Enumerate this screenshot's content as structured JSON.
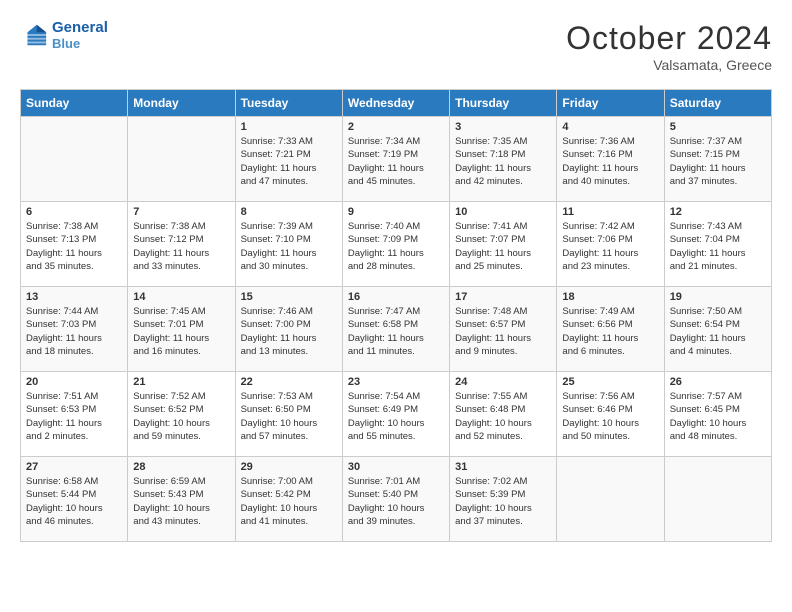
{
  "header": {
    "logo_line1": "General",
    "logo_line2": "Blue",
    "month": "October 2024",
    "location": "Valsamata, Greece"
  },
  "columns": [
    "Sunday",
    "Monday",
    "Tuesday",
    "Wednesday",
    "Thursday",
    "Friday",
    "Saturday"
  ],
  "weeks": [
    [
      {
        "day": "",
        "detail": ""
      },
      {
        "day": "",
        "detail": ""
      },
      {
        "day": "1",
        "detail": "Sunrise: 7:33 AM\nSunset: 7:21 PM\nDaylight: 11 hours\nand 47 minutes."
      },
      {
        "day": "2",
        "detail": "Sunrise: 7:34 AM\nSunset: 7:19 PM\nDaylight: 11 hours\nand 45 minutes."
      },
      {
        "day": "3",
        "detail": "Sunrise: 7:35 AM\nSunset: 7:18 PM\nDaylight: 11 hours\nand 42 minutes."
      },
      {
        "day": "4",
        "detail": "Sunrise: 7:36 AM\nSunset: 7:16 PM\nDaylight: 11 hours\nand 40 minutes."
      },
      {
        "day": "5",
        "detail": "Sunrise: 7:37 AM\nSunset: 7:15 PM\nDaylight: 11 hours\nand 37 minutes."
      }
    ],
    [
      {
        "day": "6",
        "detail": "Sunrise: 7:38 AM\nSunset: 7:13 PM\nDaylight: 11 hours\nand 35 minutes."
      },
      {
        "day": "7",
        "detail": "Sunrise: 7:38 AM\nSunset: 7:12 PM\nDaylight: 11 hours\nand 33 minutes."
      },
      {
        "day": "8",
        "detail": "Sunrise: 7:39 AM\nSunset: 7:10 PM\nDaylight: 11 hours\nand 30 minutes."
      },
      {
        "day": "9",
        "detail": "Sunrise: 7:40 AM\nSunset: 7:09 PM\nDaylight: 11 hours\nand 28 minutes."
      },
      {
        "day": "10",
        "detail": "Sunrise: 7:41 AM\nSunset: 7:07 PM\nDaylight: 11 hours\nand 25 minutes."
      },
      {
        "day": "11",
        "detail": "Sunrise: 7:42 AM\nSunset: 7:06 PM\nDaylight: 11 hours\nand 23 minutes."
      },
      {
        "day": "12",
        "detail": "Sunrise: 7:43 AM\nSunset: 7:04 PM\nDaylight: 11 hours\nand 21 minutes."
      }
    ],
    [
      {
        "day": "13",
        "detail": "Sunrise: 7:44 AM\nSunset: 7:03 PM\nDaylight: 11 hours\nand 18 minutes."
      },
      {
        "day": "14",
        "detail": "Sunrise: 7:45 AM\nSunset: 7:01 PM\nDaylight: 11 hours\nand 16 minutes."
      },
      {
        "day": "15",
        "detail": "Sunrise: 7:46 AM\nSunset: 7:00 PM\nDaylight: 11 hours\nand 13 minutes."
      },
      {
        "day": "16",
        "detail": "Sunrise: 7:47 AM\nSunset: 6:58 PM\nDaylight: 11 hours\nand 11 minutes."
      },
      {
        "day": "17",
        "detail": "Sunrise: 7:48 AM\nSunset: 6:57 PM\nDaylight: 11 hours\nand 9 minutes."
      },
      {
        "day": "18",
        "detail": "Sunrise: 7:49 AM\nSunset: 6:56 PM\nDaylight: 11 hours\nand 6 minutes."
      },
      {
        "day": "19",
        "detail": "Sunrise: 7:50 AM\nSunset: 6:54 PM\nDaylight: 11 hours\nand 4 minutes."
      }
    ],
    [
      {
        "day": "20",
        "detail": "Sunrise: 7:51 AM\nSunset: 6:53 PM\nDaylight: 11 hours\nand 2 minutes."
      },
      {
        "day": "21",
        "detail": "Sunrise: 7:52 AM\nSunset: 6:52 PM\nDaylight: 10 hours\nand 59 minutes."
      },
      {
        "day": "22",
        "detail": "Sunrise: 7:53 AM\nSunset: 6:50 PM\nDaylight: 10 hours\nand 57 minutes."
      },
      {
        "day": "23",
        "detail": "Sunrise: 7:54 AM\nSunset: 6:49 PM\nDaylight: 10 hours\nand 55 minutes."
      },
      {
        "day": "24",
        "detail": "Sunrise: 7:55 AM\nSunset: 6:48 PM\nDaylight: 10 hours\nand 52 minutes."
      },
      {
        "day": "25",
        "detail": "Sunrise: 7:56 AM\nSunset: 6:46 PM\nDaylight: 10 hours\nand 50 minutes."
      },
      {
        "day": "26",
        "detail": "Sunrise: 7:57 AM\nSunset: 6:45 PM\nDaylight: 10 hours\nand 48 minutes."
      }
    ],
    [
      {
        "day": "27",
        "detail": "Sunrise: 6:58 AM\nSunset: 5:44 PM\nDaylight: 10 hours\nand 46 minutes."
      },
      {
        "day": "28",
        "detail": "Sunrise: 6:59 AM\nSunset: 5:43 PM\nDaylight: 10 hours\nand 43 minutes."
      },
      {
        "day": "29",
        "detail": "Sunrise: 7:00 AM\nSunset: 5:42 PM\nDaylight: 10 hours\nand 41 minutes."
      },
      {
        "day": "30",
        "detail": "Sunrise: 7:01 AM\nSunset: 5:40 PM\nDaylight: 10 hours\nand 39 minutes."
      },
      {
        "day": "31",
        "detail": "Sunrise: 7:02 AM\nSunset: 5:39 PM\nDaylight: 10 hours\nand 37 minutes."
      },
      {
        "day": "",
        "detail": ""
      },
      {
        "day": "",
        "detail": ""
      }
    ]
  ]
}
